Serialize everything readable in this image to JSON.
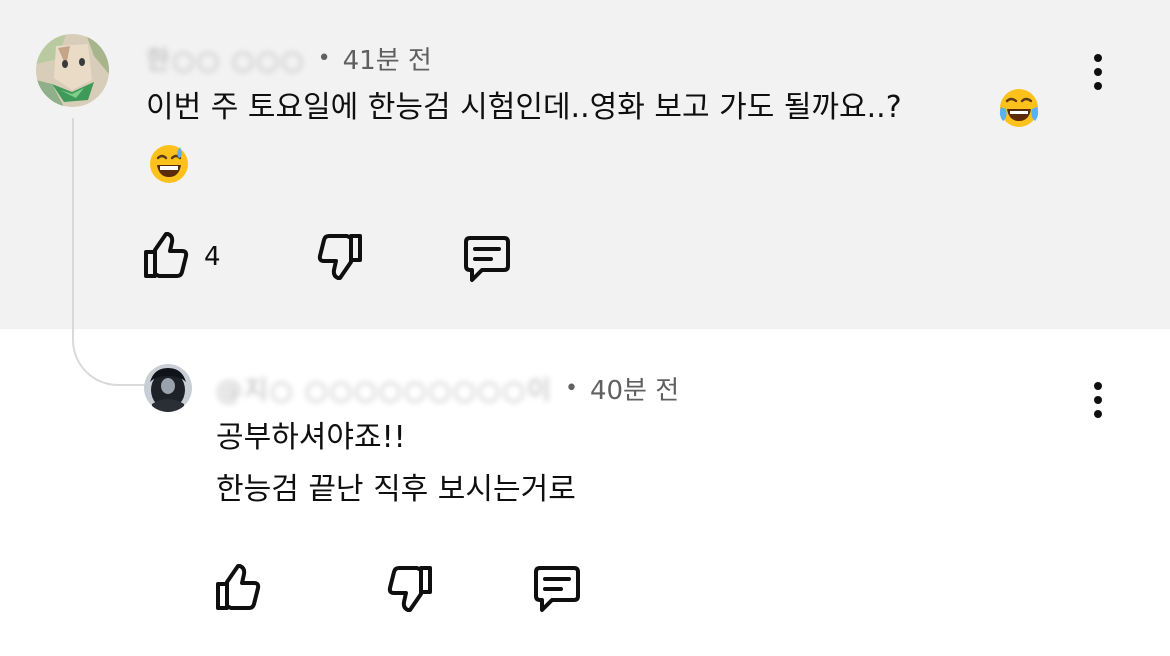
{
  "comment": {
    "author": "한○○ ○○○",
    "time": "41분 전",
    "separator": "•",
    "text": "이번 주 토요일에 한능검 시험인데..영화 보고 가도 될까요..?",
    "emoji_1": "face-with-tears-of-joy-emoji",
    "emoji_2": "grinning-face-with-sweat-emoji",
    "like_count": "4",
    "background": "#f2f2f2"
  },
  "reply": {
    "author": "@지○ ○○○○○○○○○이",
    "time": "40분 전",
    "separator": "•",
    "line_1": "공부하셔야죠!!",
    "line_2": "한능검 끝난 직후 보시는거로",
    "background": "#ffffff"
  },
  "icons": {
    "like": "thumbs-up-icon",
    "dislike": "thumbs-down-icon",
    "reply": "reply-comment-icon",
    "more": "more-vertical-icon"
  }
}
